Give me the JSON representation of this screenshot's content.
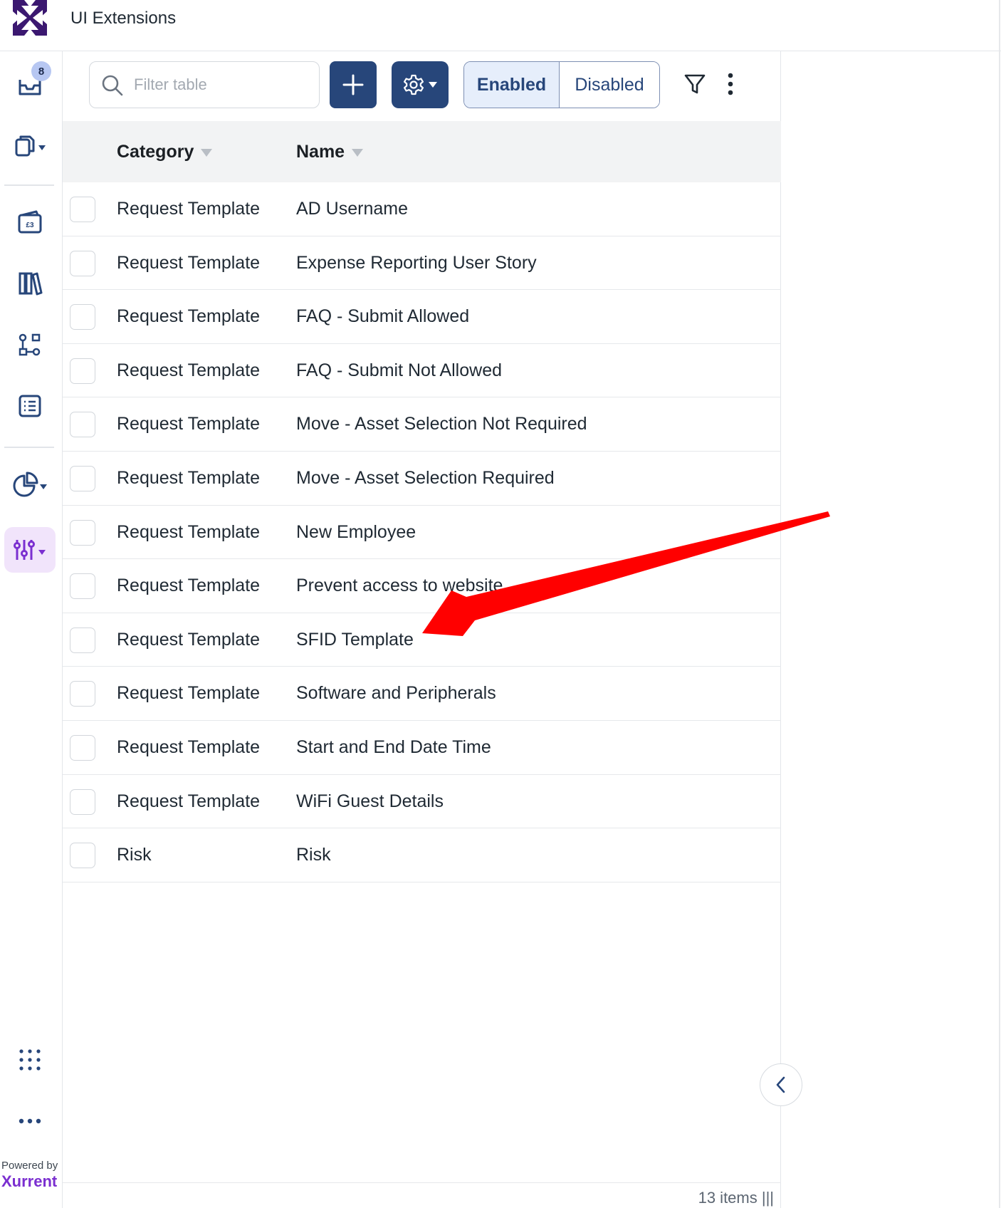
{
  "header": {
    "title": "UI Extensions"
  },
  "sidebar": {
    "inbox_badge": "8",
    "icons": [
      "inbox-icon",
      "documents-icon",
      "tickets-icon",
      "library-icon",
      "workflow-icon",
      "forms-icon",
      "reports-icon",
      "settings-sliders-icon",
      "apps-grid-icon",
      "more-icon"
    ],
    "powered_by": "Powered by",
    "brand": "Xurrent",
    "active_color": "#7b2fd0"
  },
  "toolbar": {
    "search_placeholder": "Filter table",
    "enabled_label": "Enabled",
    "disabled_label": "Disabled",
    "primary_color": "#27467a"
  },
  "table": {
    "columns": [
      "Category",
      "Name"
    ],
    "rows": [
      {
        "category": "Request Template",
        "name": "AD Username"
      },
      {
        "category": "Request Template",
        "name": "Expense Reporting User Story"
      },
      {
        "category": "Request Template",
        "name": "FAQ - Submit Allowed"
      },
      {
        "category": "Request Template",
        "name": "FAQ - Submit Not Allowed"
      },
      {
        "category": "Request Template",
        "name": "Move - Asset Selection Not Required"
      },
      {
        "category": "Request Template",
        "name": "Move - Asset Selection Required"
      },
      {
        "category": "Request Template",
        "name": "New Employee"
      },
      {
        "category": "Request Template",
        "name": "Prevent access to website"
      },
      {
        "category": "Request Template",
        "name": "SFID Template"
      },
      {
        "category": "Request Template",
        "name": "Software and Peripherals"
      },
      {
        "category": "Request Template",
        "name": "Start and End Date Time"
      },
      {
        "category": "Request Template",
        "name": "WiFi Guest Details"
      },
      {
        "category": "Risk",
        "name": "Risk"
      }
    ]
  },
  "footer": {
    "count_label": "13 items |||"
  },
  "annotation": {
    "color": "#ff0000",
    "pointing_to": "SFID Template"
  }
}
